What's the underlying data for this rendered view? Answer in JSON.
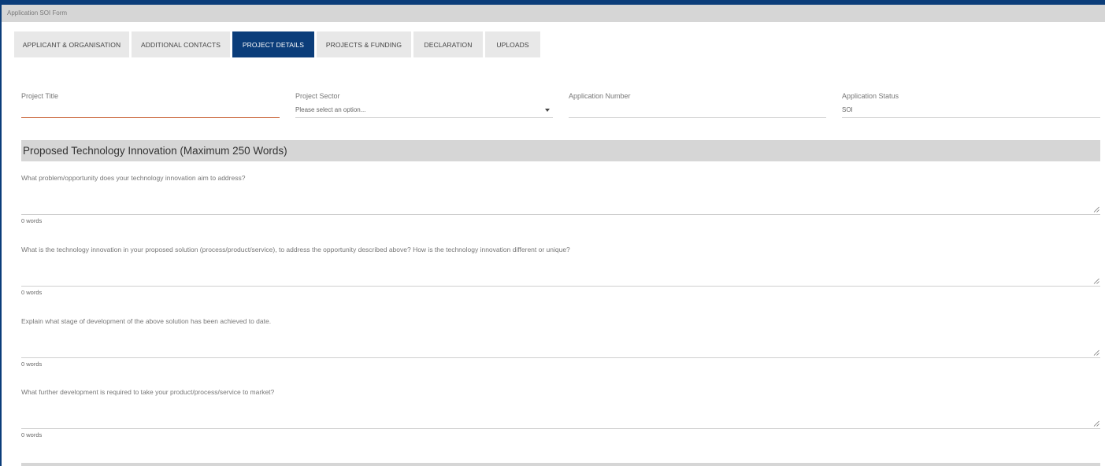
{
  "window": {
    "title": "Application SOI Form"
  },
  "tabs": [
    {
      "label": "APPLICANT & ORGANISATION",
      "active": false
    },
    {
      "label": "ADDITIONAL CONTACTS",
      "active": false
    },
    {
      "label": "PROJECT DETAILS",
      "active": true
    },
    {
      "label": "PROJECTS & FUNDING",
      "active": false
    },
    {
      "label": "DECLARATION",
      "active": false
    },
    {
      "label": "UPLOADS",
      "active": false
    }
  ],
  "fields": {
    "project_title": {
      "label": "Project Title",
      "value": ""
    },
    "project_sector": {
      "label": "Project Sector",
      "value": "Please select an option..."
    },
    "application_number": {
      "label": "Application Number",
      "value": ""
    },
    "application_status": {
      "label": "Application Status",
      "value": "SOI"
    }
  },
  "section": {
    "title": "Proposed Technology Innovation (Maximum 250 Words)"
  },
  "questions": [
    {
      "label": "What problem/opportunity does your technology innovation aim to address?",
      "word_count": "0 words"
    },
    {
      "label": "What is the technology innovation in your proposed solution (process/product/service), to address the opportunity described above? How is the technology innovation different or unique?",
      "word_count": "0 words"
    },
    {
      "label": "Explain what stage of development of the above solution has been achieved to date.",
      "word_count": "0 words"
    },
    {
      "label": "What further development is required to take your product/process/service to market?",
      "word_count": "0 words"
    }
  ],
  "colors": {
    "brand": "#0b3d7a",
    "header_gray": "#d6d6d6",
    "error_underline": "#c65a2c"
  },
  "icons": {
    "dropdown": "chevron-down-icon",
    "resize": "resize-handle-icon"
  }
}
